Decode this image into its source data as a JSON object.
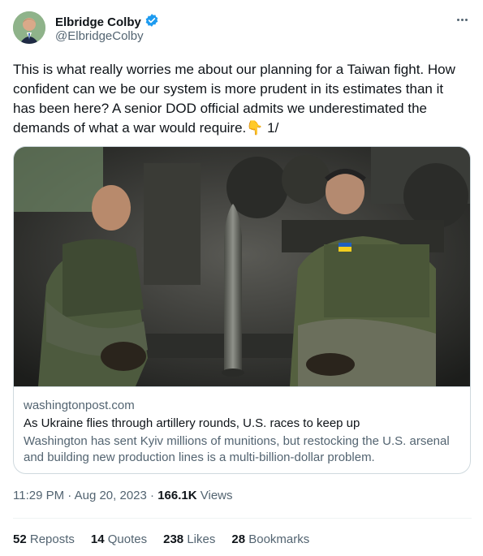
{
  "author": {
    "display_name": "Elbridge Colby",
    "handle": "@ElbridgeColby",
    "verified": true
  },
  "tweet": {
    "text": "This is what really worries me about our planning for a Taiwan fight. How confident can we be our system is more prudent in its estimates than it has been here? A senior DOD official admits we underestimated the demands of what a war would require.",
    "emoji": "👇",
    "thread_marker": "1/"
  },
  "link_card": {
    "domain": "washingtonpost.com",
    "title": "As Ukraine flies through artillery rounds, U.S. races to keep up",
    "description": "Washington has sent Kyiv millions of munitions, but restocking the U.S. arsenal and building new production lines is a multi-billion-dollar problem."
  },
  "meta": {
    "time": "11:29 PM",
    "separator": "·",
    "date": "Aug 20, 2023",
    "views_count": "166.1K",
    "views_label": "Views"
  },
  "stats": {
    "reposts_count": "52",
    "reposts_label": "Reposts",
    "quotes_count": "14",
    "quotes_label": "Quotes",
    "likes_count": "238",
    "likes_label": "Likes",
    "bookmarks_count": "28",
    "bookmarks_label": "Bookmarks"
  },
  "colors": {
    "text": "#0f1419",
    "secondary": "#536471",
    "verified": "#1d9bf0",
    "border": "#cfd9de"
  }
}
